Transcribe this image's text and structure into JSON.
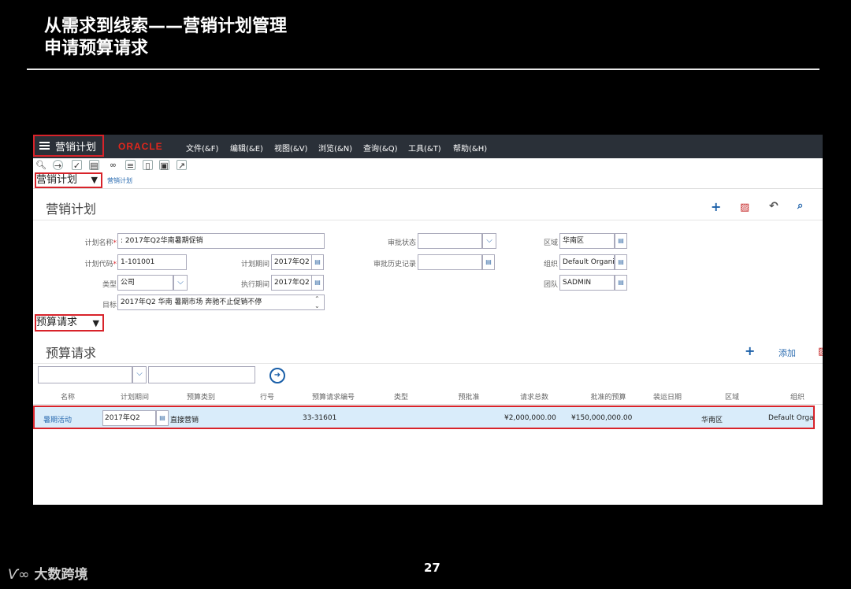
{
  "slide": {
    "title_line1": "从需求到线索——营销计划管理",
    "title_line2": "申请预算请求",
    "page_number": "27",
    "brand_mark": "Ѵ∞",
    "brand_name": "大数跨境"
  },
  "menubar": {
    "app_menu_label": "营销计划",
    "logo": "ORACLE",
    "items": [
      "文件(&F)",
      "编辑(&E)",
      "视图(&V)",
      "浏览(&N)",
      "查询(&Q)",
      "工具(&T)",
      "帮助(&H)"
    ]
  },
  "viewbar": {
    "view_label": "营销计划",
    "breadcrumb": "营销计划"
  },
  "form": {
    "title": "营销计划",
    "labels": {
      "plan_name": "计划名称",
      "plan_code": "计划代码",
      "type": "类型",
      "objective": "目标",
      "plan_period": "计划期间",
      "exec_period": "执行期间",
      "approval_status": "审批状态",
      "approval_history": "审批历史记录",
      "region": "区域",
      "organization": "组织",
      "team": "团队"
    },
    "values": {
      "plan_name": "2017年Q2华南暑期促销",
      "plan_code": "1-101001",
      "type": "公司",
      "objective": "2017年Q2 华南  暑期市场  奔驰不止促销不停",
      "plan_period": "2017年Q2",
      "exec_period": "2017年Q2",
      "approval_status": "",
      "approval_history": "",
      "region": "华南区",
      "organization": "Default Organization",
      "team": "SADMIN"
    }
  },
  "budget": {
    "view_label": "预算请求",
    "title": "预算请求",
    "add_label": "添加",
    "columns": [
      "名称",
      "计划期间",
      "预算类别",
      "行号",
      "预算请求编号",
      "类型",
      "预批准",
      "请求总数",
      "批准的预算",
      "装运日期",
      "区域",
      "组织"
    ],
    "row": {
      "name": "暑期活动",
      "plan_period": "2017年Q2",
      "category": "直接营销",
      "line_no": "",
      "request_no": "33-31601",
      "type": "",
      "pre_approved": "",
      "requested_total": "¥2,000,000.00",
      "approved_budget": "¥150,000,000.00",
      "ship_date": "",
      "region": "华南区",
      "organization": "Default Organization"
    }
  }
}
